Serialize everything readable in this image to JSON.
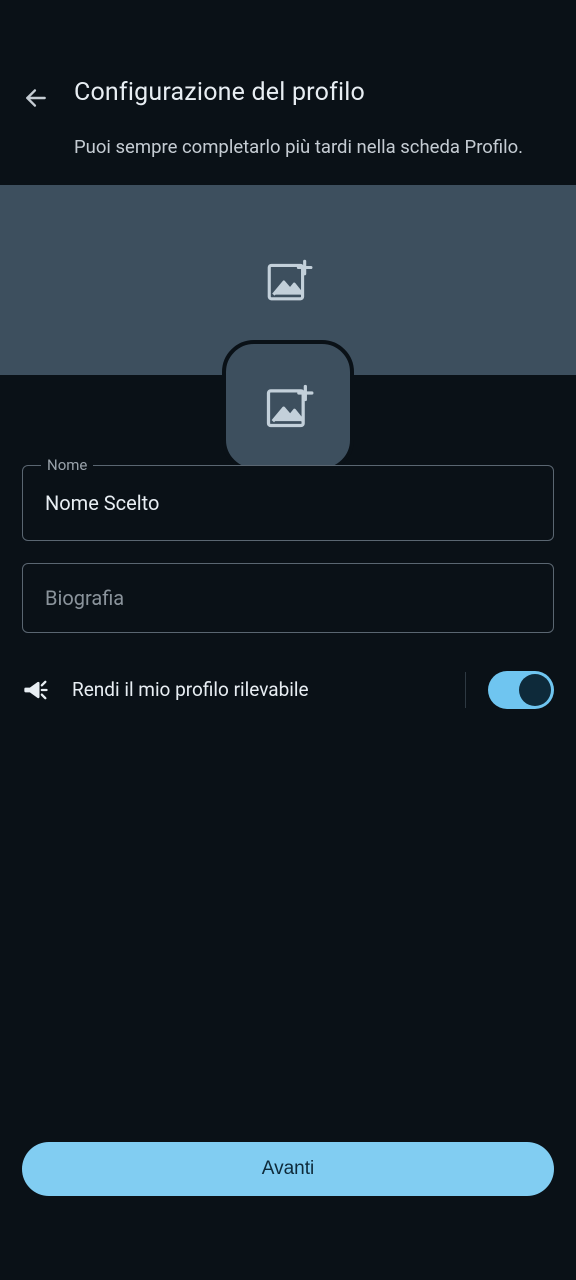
{
  "header": {
    "title": "Configurazione del profilo",
    "subtitle": "Puoi sempre completarlo più tardi nella scheda Profilo."
  },
  "form": {
    "name_label": "Nome",
    "name_value": "Nome Scelto",
    "bio_placeholder": "Biografia"
  },
  "discoverable": {
    "label": "Rendi il mio profilo rilevabile",
    "enabled": true
  },
  "actions": {
    "next": "Avanti"
  }
}
